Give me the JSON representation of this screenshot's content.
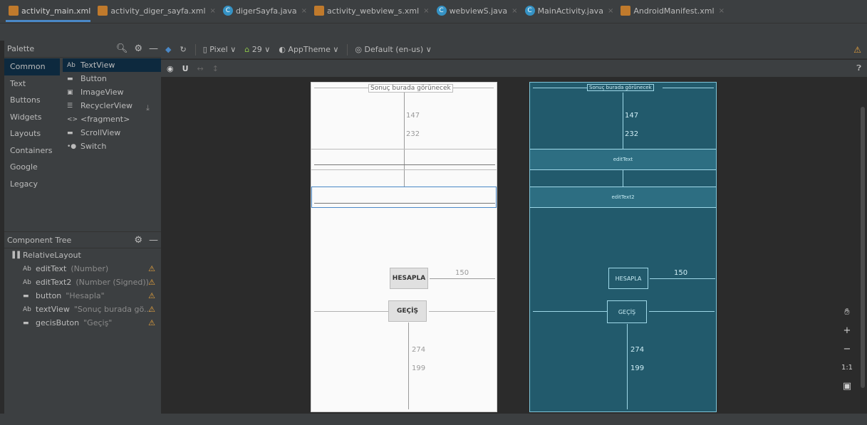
{
  "tabs": [
    {
      "label": "activity_main.xml",
      "icon": "xml-file-icon",
      "active": true
    },
    {
      "label": "activity_diger_sayfa.xml",
      "icon": "xml-file-icon"
    },
    {
      "label": "digerSayfa.java",
      "icon": "java-class-icon"
    },
    {
      "label": "activity_webview_s.xml",
      "icon": "xml-file-icon"
    },
    {
      "label": "webviewS.java",
      "icon": "java-class-icon"
    },
    {
      "label": "MainActivity.java",
      "icon": "java-class-icon"
    },
    {
      "label": "AndroidManifest.xml",
      "icon": "xml-file-icon"
    }
  ],
  "palette": {
    "title": "Palette",
    "categories": [
      "Common",
      "Text",
      "Buttons",
      "Widgets",
      "Layouts",
      "Containers",
      "Google",
      "Legacy"
    ],
    "selected_category": "Common",
    "widgets": [
      {
        "icon": "Ab",
        "label": "TextView"
      },
      {
        "icon": "▬",
        "label": "Button"
      },
      {
        "icon": "▣",
        "label": "ImageView"
      },
      {
        "icon": "☰",
        "label": "RecyclerView"
      },
      {
        "icon": "<>",
        "label": "<fragment>"
      },
      {
        "icon": "▬",
        "label": "ScrollView"
      },
      {
        "icon": "•●",
        "label": "Switch"
      }
    ]
  },
  "component_tree": {
    "title": "Component Tree",
    "root": "RelativeLayout",
    "nodes": [
      {
        "icon": "Ab",
        "name": "editText",
        "detail": "(Number)"
      },
      {
        "icon": "Ab",
        "name": "editText2",
        "detail": "(Number (Signed))"
      },
      {
        "icon": "▬",
        "name": "button",
        "detail": "\"Hesapla\""
      },
      {
        "icon": "Ab",
        "name": "textView",
        "detail": "\"Sonuç burada gö..."
      },
      {
        "icon": "▬",
        "name": "gecisButon",
        "detail": "\"Geçiş\""
      }
    ]
  },
  "toolbar": {
    "device": "Pixel",
    "api": "29",
    "theme": "AppTheme",
    "locale": "Default (en-us)"
  },
  "design": {
    "textview": "Sonuç burada görünecek",
    "dim1": "147",
    "dim2": "232",
    "dim3": "150",
    "dim4": "274",
    "dim5": "199",
    "hesapla": "HESAPLA",
    "gecis": "GEÇİŞ"
  },
  "blueprint": {
    "textview": "Sonuç burada görünecek",
    "edittext": "editText",
    "edittext2": "editText2",
    "hesapla": "HESAPLA",
    "gecis": "GEÇİŞ",
    "dim1": "147",
    "dim2": "232",
    "dim3": "150",
    "dim4": "274",
    "dim5": "199"
  },
  "zoom": {
    "one_to_one": "1:1"
  },
  "colors": {
    "warning": "#e8a33d",
    "accent": "#4a88c7",
    "blueprint": "#225a6c"
  }
}
